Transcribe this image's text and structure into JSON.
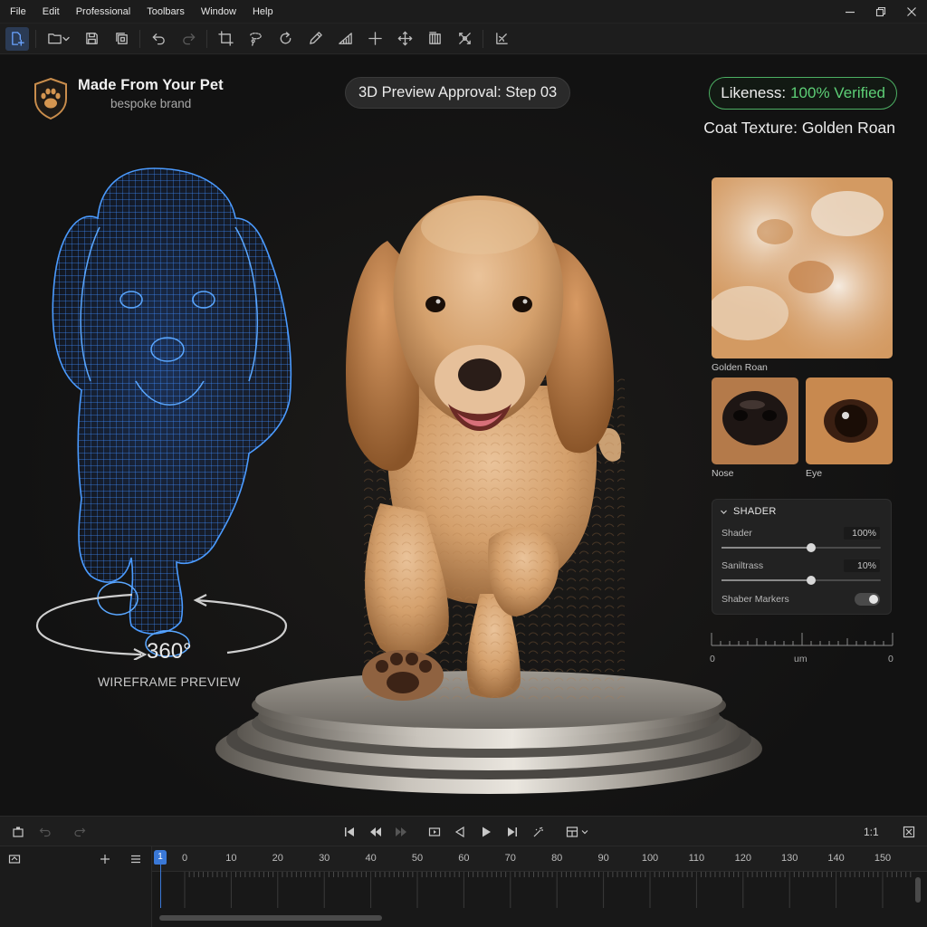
{
  "menu": {
    "items": [
      "File",
      "Edit",
      "Professional",
      "Toolbars",
      "Window",
      "Help"
    ]
  },
  "header": {
    "brand_name": "Made From Your Pet",
    "brand_tag": "bespoke brand",
    "step": "3D Preview Approval: Step 03",
    "likeness_label": "Likeness:",
    "likeness_value": "100% Verified",
    "coat_texture": "Coat Texture: Golden Roan"
  },
  "swatches": {
    "main_label": "Golden Roan",
    "nose_label": "Nose",
    "eye_label": "Eye"
  },
  "shader_panel": {
    "title": "SHADER",
    "rows": [
      {
        "label": "Shader",
        "value": "100%",
        "level": 0.56
      },
      {
        "label": "Saniltrass",
        "value": "10%",
        "level": 0.56
      }
    ],
    "toggle_label": "Shaber Markers",
    "toggle_on": true
  },
  "ruler": {
    "left": "0",
    "center": "um",
    "right": "0"
  },
  "wireframe": {
    "rotation": "360°",
    "label": "WIREFRAME PREVIEW"
  },
  "playback": {
    "zoom": "1:1"
  },
  "timeline": {
    "playhead": "1",
    "marks": [
      "0",
      "10",
      "20",
      "30",
      "40",
      "50",
      "60",
      "70",
      "80",
      "90",
      "100",
      "110",
      "120",
      "130",
      "140",
      "150"
    ]
  },
  "colors": {
    "accent_blue": "#3a78d6",
    "verified_green": "#5dcf76",
    "wireframe_blue": "#3d8cff",
    "fur": "#d9a677"
  }
}
